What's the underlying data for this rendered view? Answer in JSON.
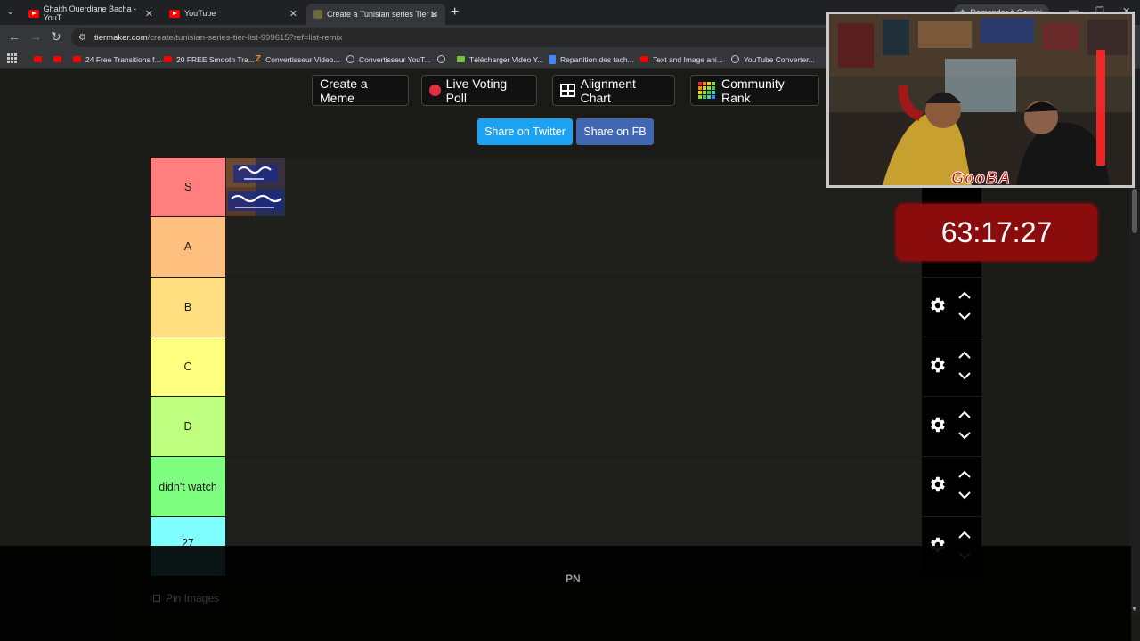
{
  "browser": {
    "tabs": [
      {
        "title": "Ghaith Ouerdiane Bacha - YouT",
        "active": false
      },
      {
        "title": "YouTube",
        "active": false
      },
      {
        "title": "Create a Tunisian series Tier Li",
        "active": true
      }
    ],
    "gemini_label": "Demander à Gemini",
    "url_host": "tiermaker.com",
    "url_path": "/create/tunisian-series-tier-list-999615?ref=list-remix",
    "bookmarks": [
      "24 Free Transitions f...",
      "20 FREE Smooth Tra...",
      "Convertisseur Video...",
      "Convertisseur YouT...",
      "Télécharger Vidéo Y...",
      "Repartition des tach...",
      "Text and Image ani...",
      "YouTube Converter..."
    ]
  },
  "page": {
    "buttons": {
      "create_meme": "Create a Meme",
      "live_voting": "Live Voting Poll",
      "alignment": "Alignment Chart",
      "community": "Community Rank"
    },
    "share_twitter": "Share on Twitter",
    "share_fb": "Share on FB",
    "tiers": [
      {
        "label": "S",
        "color": "#ff7f7f"
      },
      {
        "label": "A",
        "color": "#ffbf7f"
      },
      {
        "label": "B",
        "color": "#ffdf7f"
      },
      {
        "label": "C",
        "color": "#ffff7f"
      },
      {
        "label": "D",
        "color": "#bfff7f"
      },
      {
        "label": "didn't watch",
        "color": "#7fff7f"
      },
      {
        "label": "27",
        "color": "#7fffff"
      }
    ],
    "footer_pn": "PN",
    "pin_images": "Pin Images"
  },
  "overlay": {
    "timer": "63:17:27",
    "brand": "GooBA"
  }
}
